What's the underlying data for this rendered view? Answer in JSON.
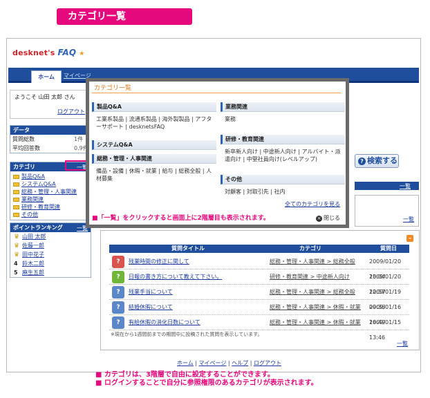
{
  "banner": {
    "title": "カテゴリ一覧"
  },
  "logo": {
    "part1": "desknet's",
    "part2": "FAQ"
  },
  "nav": {
    "home": "ホーム",
    "mypage": "マイページ"
  },
  "welcome": {
    "text": "ようこそ 山田 太郎 さん",
    "logout": "ログアウト"
  },
  "data_box": {
    "title": "データ",
    "rows": [
      {
        "label": "質問総数",
        "value": "1件"
      },
      {
        "label": "平均回答数",
        "value": "0.9件"
      }
    ]
  },
  "category_box": {
    "title": "カテゴリ",
    "ichiran": "一覧",
    "items": [
      "製品Q&A",
      "システムQ&A",
      "総務・管理・人事関連",
      "業務関連",
      "研修・教育関連",
      "その他"
    ]
  },
  "ranking_box": {
    "title": "ポイントランキング",
    "ichiran": "一覧",
    "rows": [
      {
        "rank": "",
        "name": "山田 太郎"
      },
      {
        "rank": "",
        "name": "佐藤一郎"
      },
      {
        "rank": "",
        "name": "田中花子"
      },
      {
        "rank": "4",
        "name": "鈴木二郎"
      },
      {
        "rank": "5",
        "name": "麻生五郎"
      }
    ]
  },
  "popup": {
    "title": "カテゴリ一覧",
    "left": [
      {
        "head": "製品Q&A",
        "body": "工業系製品 | 流通系製品 | 海外製製品 | アフターサポート | desknetsFAQ"
      },
      {
        "head": "システムQ&A",
        "body": ""
      },
      {
        "head": "総務・管理・人事関連",
        "body": "備品・設備 | 休暇・就業 | 給与 | 総務全般 | 人材募集"
      }
    ],
    "right": [
      {
        "head": "業務関連",
        "body": "業務"
      },
      {
        "head": "研修・教育関連",
        "body": "新卒新人向け | 中途新人向け | アルバイト・派遣向け | 中堅社員向け(レベルアップ)"
      },
      {
        "head": "その他",
        "body": "対顧客 | 対取引先 | 社内"
      }
    ],
    "all_link": "全てのカテゴリを見る",
    "hint": "■「一覧」をクリックすると画面上に2階層目も表示されます。",
    "close": "閉じる"
  },
  "search": {
    "label": "検索する"
  },
  "side_ichiran": "一覧",
  "table": {
    "headers": {
      "title": "質問タイトル",
      "category": "カテゴリ",
      "date": "質問日"
    },
    "rows": [
      {
        "title": "残業時間の修正に関して",
        "category": "総務・管理・人事関連 > 総務全般",
        "date": "2009/01/20 15:04",
        "color": "#d9534f"
      },
      {
        "title": "日報の書き方について教えて下さい。",
        "category": "研修・教育関連 > 中途新人向け",
        "date": "2009/01/20 12:57",
        "color": "#6fb63a"
      },
      {
        "title": "残業手当について",
        "category": "総務・管理・人事関連 > 総務全般",
        "date": "2009/01/19 09:36",
        "color": "#5b86c8"
      },
      {
        "title": "結婚休暇について",
        "category": "総務・管理・人事関連 > 休暇・就業",
        "date": "2009/01/16 18:49",
        "color": "#5b86c8"
      },
      {
        "title": "有給休暇の消化日数について",
        "category": "総務・管理・人事関連 > 休暇・就業",
        "date": "2009/01/15 13:46",
        "color": "#5b86c8"
      }
    ],
    "note": "※現在から1週間前までの期間中に投稿された質問を表示しています。",
    "ichiran": "一覧"
  },
  "footer": {
    "home": "ホーム",
    "mypage": "マイページ",
    "help": "ヘルプ",
    "logout": "ログアウト"
  },
  "bottom_notes": [
    "■ カテゴリは、3階層で自由に設定することができます。",
    "■ ログインすることで自分に参照権限のあるカテゴリが表示されます。"
  ],
  "colors": {
    "accent": "#e6087d",
    "nav": "#1f4e9c",
    "popup_title": "#e07a1e"
  }
}
